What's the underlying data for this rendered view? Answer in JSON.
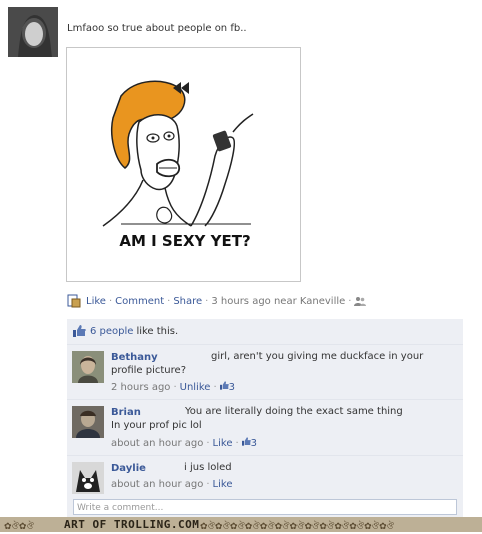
{
  "post": {
    "status": "Lmfaoo so true about people on fb..",
    "image_caption": "AM I SEXY YET?",
    "actions": {
      "like": "Like",
      "comment": "Comment",
      "share": "Share",
      "time": "3 hours ago near Kaneville"
    },
    "likes_count": "6 people",
    "likes_suffix": "like this."
  },
  "comments": [
    {
      "name": "Bethany",
      "text_line1": "girl, aren't you giving me duckface in your",
      "text_line2": "profile picture?",
      "time": "2 hours ago",
      "action": "Unlike",
      "likes": "3"
    },
    {
      "name": "Brian",
      "text_line1": "You are literally doing the exact same thing",
      "text_line2": "In your prof pic lol",
      "time": "about an hour ago",
      "action": "Like",
      "likes": "3"
    },
    {
      "name": "Daylie",
      "text_line1": "i jus loled",
      "time": "about an hour ago",
      "action": "Like"
    }
  ],
  "comment_box": {
    "placeholder": "Write a comment..."
  },
  "footer": {
    "site": "ART OF TROLLING.COM"
  },
  "colors": {
    "link": "#3b5998",
    "panel": "#edeff4",
    "footer": "#bdb096"
  }
}
